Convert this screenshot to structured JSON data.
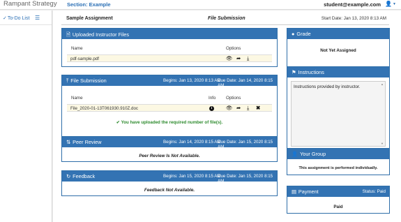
{
  "topbar": {
    "brand": "Rampant Strategy",
    "section": "Section: Example",
    "user_email": "student@example.com",
    "user_icon": "user-icon"
  },
  "sidebar": {
    "todo_label": "To-Do List"
  },
  "assignment": {
    "name": "Sample Assignment",
    "type": "File Submission",
    "start_date": "Start Date: Jan 13, 2020 8:13 AM"
  },
  "instructor_files": {
    "title": "Uploaded Instructor Files",
    "col_name": "Name",
    "col_options": "Options",
    "files": [
      {
        "name": "pdf-sample.pdf"
      }
    ]
  },
  "file_submission": {
    "title": "File Submission",
    "begins": "Begins: Jan 13, 2020 8:13 AM",
    "due": "Due Date: Jan 14, 2020 8:15 AM",
    "col_name": "Name",
    "col_info": "Info",
    "col_options": "Options",
    "files": [
      {
        "name": "File_2020-01-13T061930.910Z.doc"
      }
    ],
    "message": "You have uploaded the required number of file(s)."
  },
  "peer_review": {
    "title": "Peer Review",
    "begins": "Begins: Jan 14, 2020 8:15 AM",
    "due": "Due Date: Jan 15, 2020 8:15 AM",
    "message": "Peer Review Is Not Available."
  },
  "feedback": {
    "title": "Feedback",
    "begins": "Begins: Jan 15, 2020 8:15 AM",
    "due": "Due Date: Jan 15, 2020 8:15 AM",
    "message": "Feedback Not Available."
  },
  "grade": {
    "title": "Grade",
    "value": "Not Yet Assigned"
  },
  "instructions": {
    "title": "Instructions",
    "text": "Instructions provided by instructor."
  },
  "group": {
    "title": "Your Group",
    "text": "This assignment is performed individually."
  },
  "payment": {
    "title": "Payment",
    "status": "Status: Paid",
    "value": "Paid"
  },
  "colors": {
    "panel_header": "#3373b3",
    "link": "#2a6fb5",
    "success": "#2e8b2e",
    "row_highlight": "#fcf8e3"
  }
}
